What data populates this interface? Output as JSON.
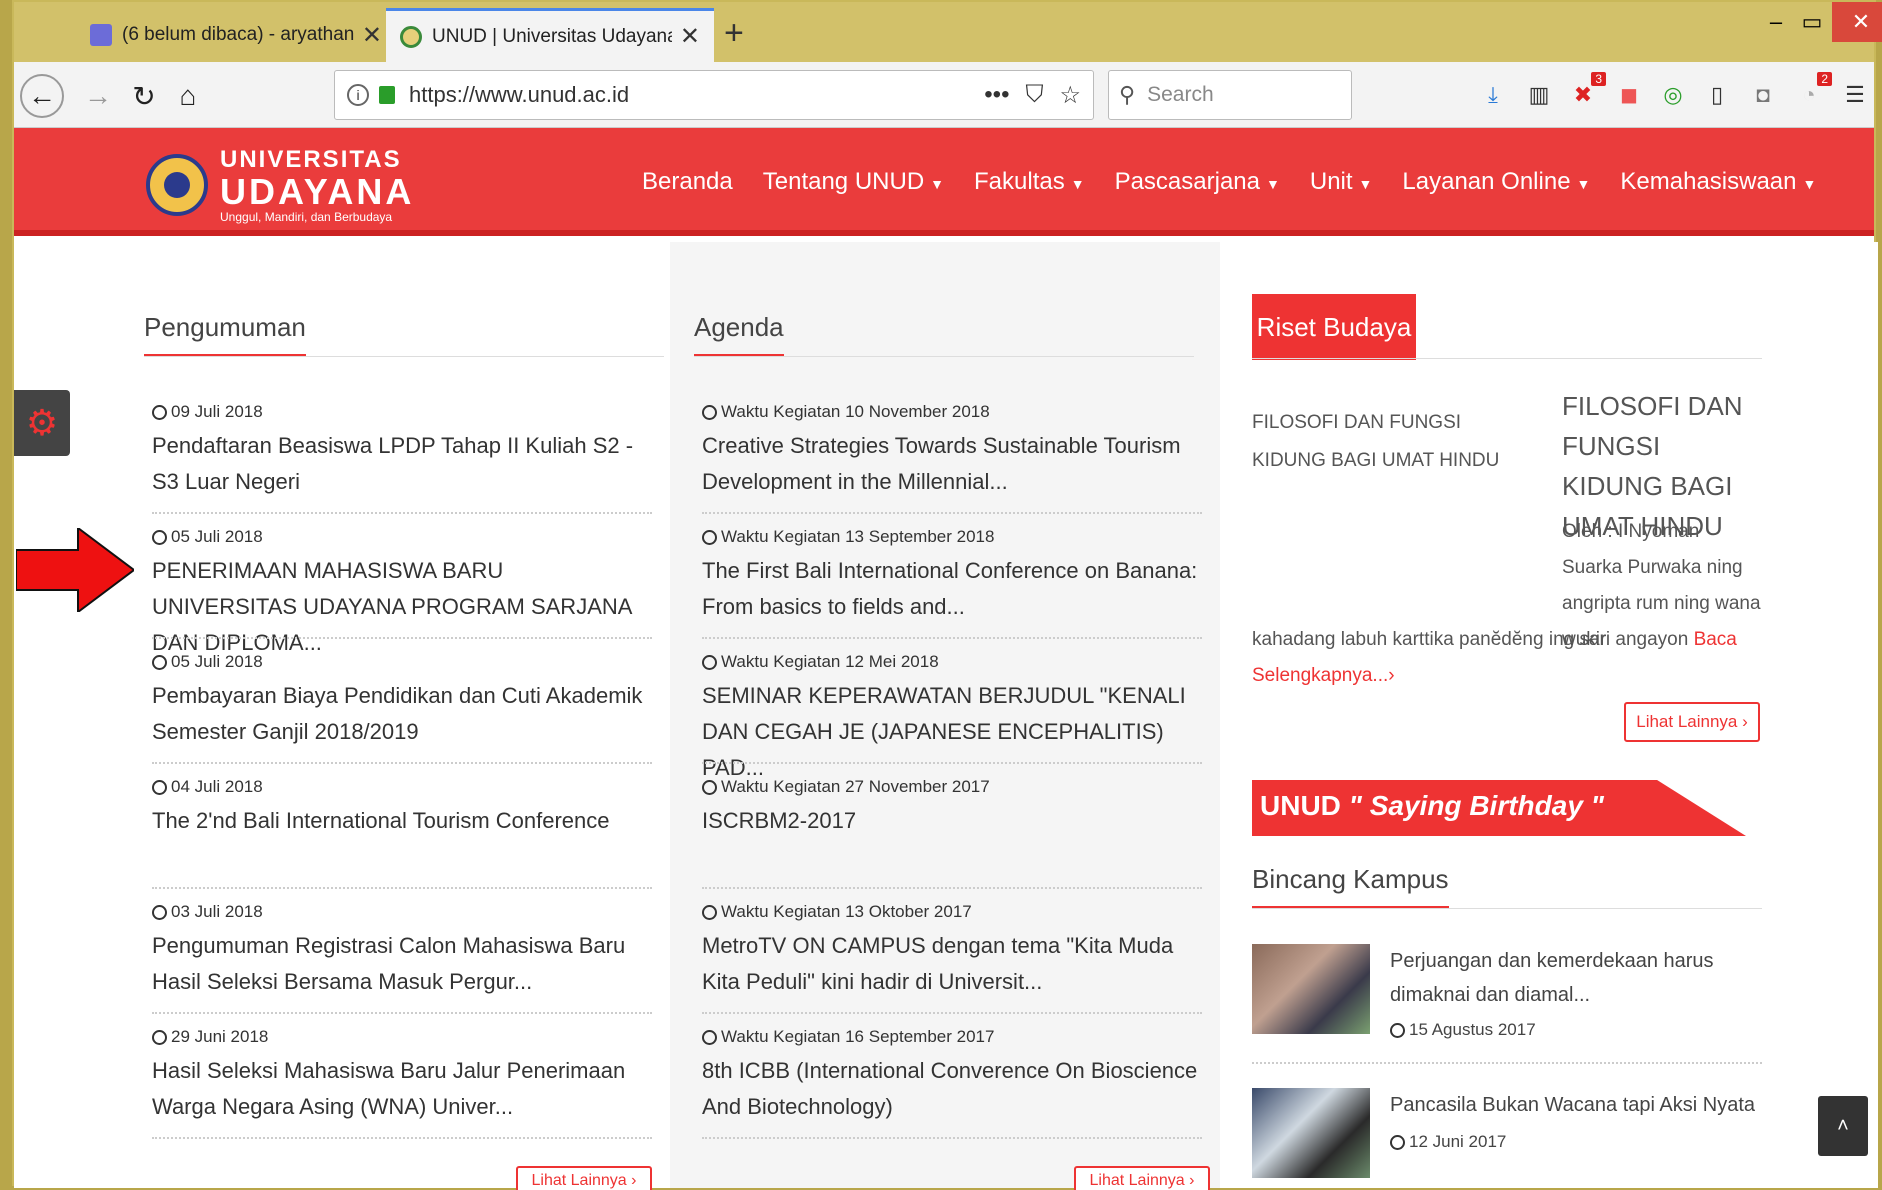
{
  "browser": {
    "tabs": [
      {
        "label": "(6 belum dibaca) - aryathanaya",
        "icon": "mail-icon"
      },
      {
        "label": "UNUD | Universitas Udayana",
        "icon": "site-favicon"
      }
    ],
    "new_tab": "+",
    "url": "https://www.unud.ac.id",
    "search_placeholder": "Search",
    "badges": {
      "addon1": "3",
      "notifications": "2"
    },
    "win": {
      "min": "–",
      "max": "▭",
      "close": "✕"
    }
  },
  "site": {
    "logo": {
      "line1": "UNIVERSITAS",
      "line2": "UDAYANA",
      "tagline": "Unggul, Mandiri, dan Berbudaya"
    },
    "nav": [
      {
        "label": "Beranda",
        "dropdown": false
      },
      {
        "label": "Tentang UNUD",
        "dropdown": true
      },
      {
        "label": "Fakultas",
        "dropdown": true
      },
      {
        "label": "Pascasarjana",
        "dropdown": true
      },
      {
        "label": "Unit",
        "dropdown": true
      },
      {
        "label": "Layanan Online",
        "dropdown": true
      },
      {
        "label": "Kemahasiswaan",
        "dropdown": true
      }
    ],
    "accent": "#ea3c3c"
  },
  "pengumuman": {
    "heading": "Pengumuman",
    "items": [
      {
        "date": "09 Juli 2018",
        "title": "Pendaftaran Beasiswa LPDP Tahap II Kuliah S2 - S3 Luar Negeri"
      },
      {
        "date": "05 Juli 2018",
        "title": "PENERIMAAN MAHASISWA BARU UNIVERSITAS UDAYANA PROGRAM SARJANA DAN DIPLOMA..."
      },
      {
        "date": "05 Juli 2018",
        "title": "Pembayaran Biaya Pendidikan dan Cuti Akademik Semester Ganjil 2018/2019"
      },
      {
        "date": "04 Juli 2018",
        "title": "The 2'nd Bali International Tourism Conference"
      },
      {
        "date": "03 Juli 2018",
        "title": "Pengumuman Registrasi Calon Mahasiswa Baru Hasil Seleksi Bersama Masuk Pergur..."
      },
      {
        "date": "29 Juni 2018",
        "title": "Hasil Seleksi Mahasiswa Baru Jalur Penerimaan Warga Negara Asing (WNA) Univer..."
      }
    ],
    "more": "Lihat Lainnya ›"
  },
  "agenda": {
    "heading": "Agenda",
    "items": [
      {
        "date": "Waktu Kegiatan 10 November 2018",
        "title": "Creative Strategies Towards Sustainable Tourism Development in the Millennial..."
      },
      {
        "date": "Waktu Kegiatan 13 September 2018",
        "title": "The First Bali International Conference on Banana: From basics to fields and..."
      },
      {
        "date": "Waktu Kegiatan 12 Mei 2018",
        "title": "SEMINAR KEPERAWATAN BERJUDUL \"KENALI DAN CEGAH JE (JAPANESE ENCEPHALITIS) PAD..."
      },
      {
        "date": "Waktu Kegiatan 27 November 2017",
        "title": "ISCRBM2-2017"
      },
      {
        "date": "Waktu Kegiatan 13 Oktober 2017",
        "title": "MetroTV ON CAMPUS dengan tema \"Kita Muda Kita Peduli\" kini hadir di Universit..."
      },
      {
        "date": "Waktu Kegiatan 16 September 2017",
        "title": "8th ICBB (International Converence On Bioscience And Biotechnology)"
      }
    ],
    "more": "Lihat Lainnya ›"
  },
  "riset": {
    "tab": "Riset Budaya",
    "small_title": "FILOSOFI DAN FUNGSI KIDUNG BAGI UMAT HINDU",
    "big_title": "FILOSOFI DAN FUNGSI KIDUNG BAGI UMAT HINDU",
    "body": "Oleh : I Nyoman Suarka Purwaka ning angripta rum ning wana wukir",
    "body_cont": "kahadang labuh karttika panĕdĕng ing sari angayon",
    "read_more": "Baca Selengkapnya...›",
    "more": "Lihat Lainnya ›"
  },
  "birthday": {
    "prefix": "UNUD",
    "italic": "\" Saying Birthday \""
  },
  "bincang": {
    "heading": "Bincang Kampus",
    "items": [
      {
        "title": "Perjuangan dan kemerdekaan harus dimaknai dan diamal...",
        "date": "15 Agustus 2017"
      },
      {
        "title": "Pancasila Bukan Wacana tapi Aksi Nyata",
        "date": "12 Juni 2017"
      }
    ]
  },
  "scroll_top": "˄"
}
